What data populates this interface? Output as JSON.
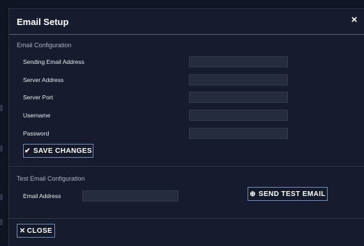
{
  "dialog": {
    "title": "Email Setup",
    "close_icon": "×"
  },
  "email_configuration": {
    "heading": "Email Configuration",
    "fields": [
      {
        "label": "Sending Email Address",
        "value": "",
        "placeholder": ""
      },
      {
        "label": "Server Address",
        "value": "",
        "placeholder": ""
      },
      {
        "label": "Server Port",
        "value": "",
        "placeholder": ""
      },
      {
        "label": "Username",
        "value": "",
        "placeholder": ""
      },
      {
        "label": "Password",
        "value": "",
        "placeholder": ""
      }
    ],
    "save_button": {
      "icon": "check-icon",
      "icon_glyph": "✔",
      "label": "SAVE CHANGES"
    }
  },
  "test_configuration": {
    "heading": "Test Email Configuration",
    "email_label": "Email Address",
    "email_value": "",
    "email_placeholder": "",
    "send_button": {
      "icon": "plus-circle-icon",
      "icon_glyph": "⊕",
      "label": "SEND TEST EMAIL"
    }
  },
  "footer": {
    "close_button": {
      "icon": "close-icon",
      "icon_glyph": "✕",
      "label": "CLOSE"
    }
  },
  "colors": {
    "background": "#0e1421",
    "panel": "#161c2d",
    "input": "#252c3d",
    "button_border": "#6f8bb8"
  }
}
